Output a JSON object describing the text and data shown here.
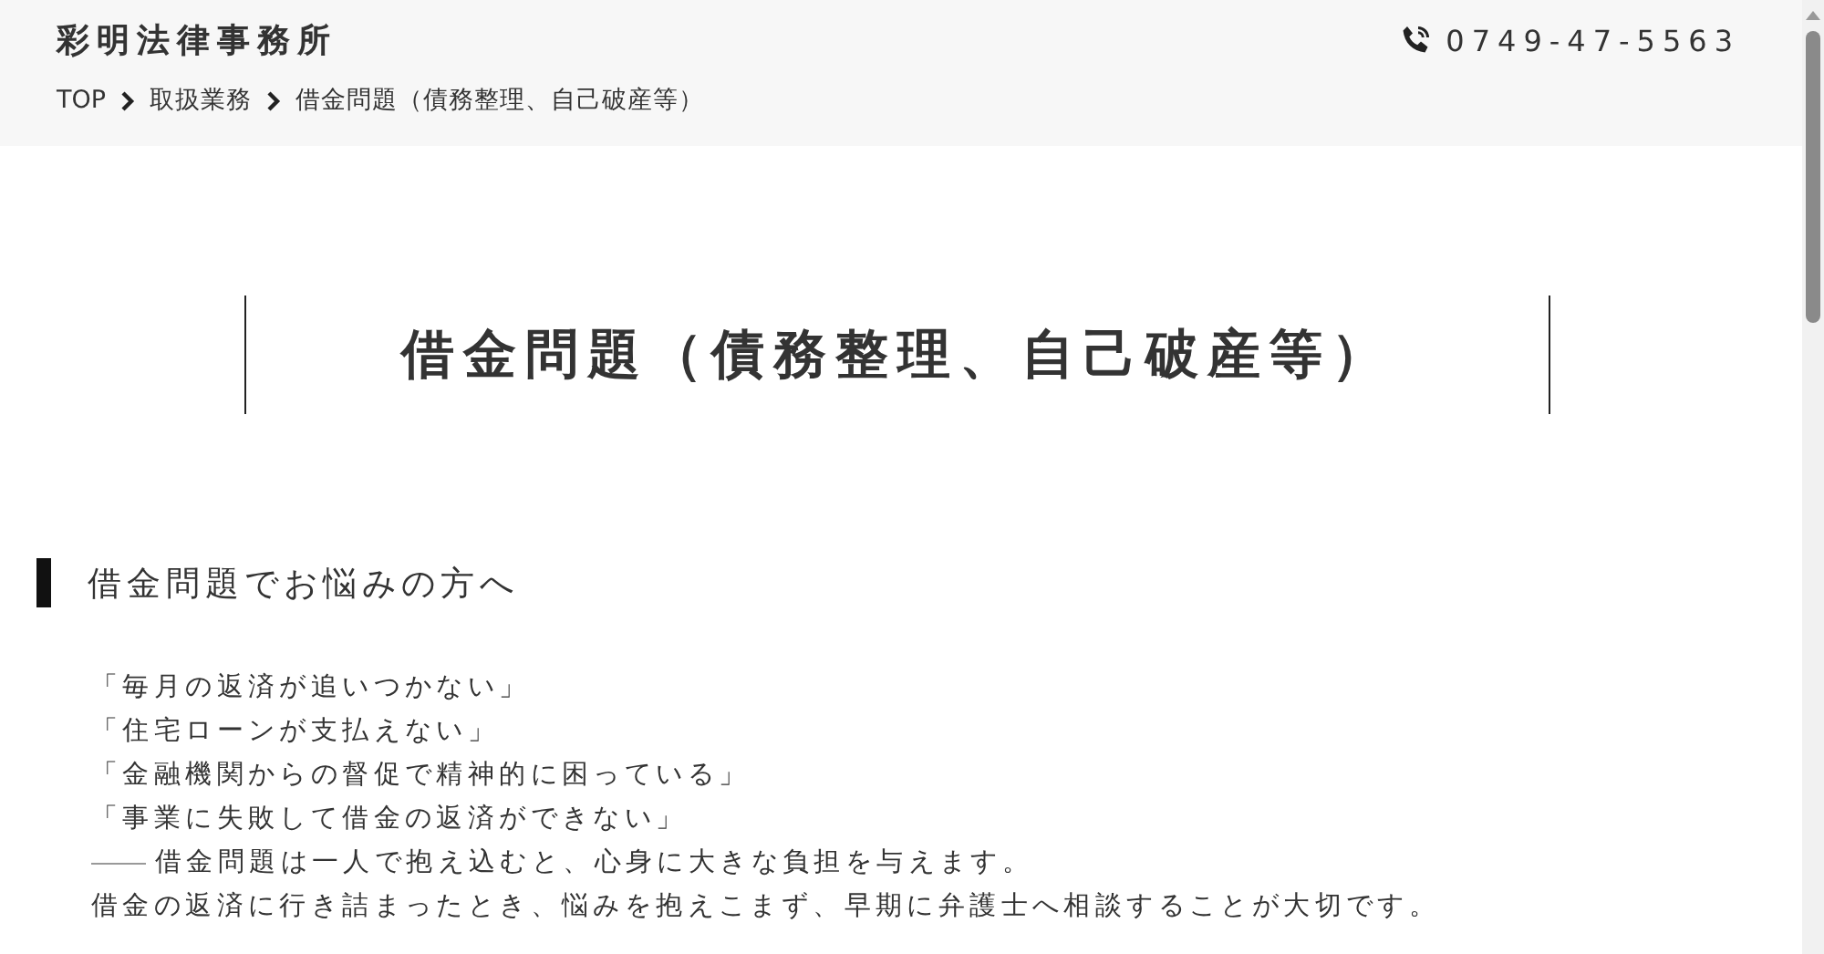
{
  "header": {
    "site_title": "彩明法律事務所",
    "phone": "0749-47-5563"
  },
  "breadcrumb": [
    {
      "label": "TOP"
    },
    {
      "label": "取扱業務"
    },
    {
      "label": "借金問題（債務整理、自己破産等）"
    }
  ],
  "page_title": "借金問題（債務整理、自己破産等）",
  "section": {
    "heading": "借金問題でお悩みの方へ",
    "lines": [
      "「毎月の返済が追いつかない」",
      "「住宅ローンが支払えない」",
      "「金融機関からの督促で精神的に困っている」",
      "「事業に失敗して借金の返済ができない」"
    ],
    "dash_line": "借金問題は一人で抱え込むと、心身に大きな負担を与えます。",
    "last_line": "借金の返済に行き詰まったとき、悩みを抱えこまず、早期に弁護士へ相談することが大切です。"
  }
}
